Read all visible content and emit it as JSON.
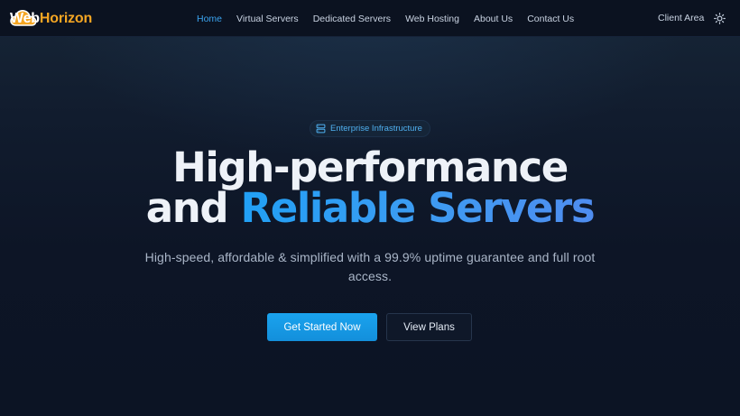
{
  "brand": {
    "name_part1": "Web",
    "name_part2": "Horizon",
    "logo_icon": "cloud-logo-icon"
  },
  "nav": {
    "items": [
      {
        "label": "Home",
        "active": true
      },
      {
        "label": "Virtual Servers",
        "active": false
      },
      {
        "label": "Dedicated Servers",
        "active": false
      },
      {
        "label": "Web Hosting",
        "active": false
      },
      {
        "label": "About Us",
        "active": false
      },
      {
        "label": "Contact Us",
        "active": false
      }
    ],
    "client_area_label": "Client Area",
    "theme_toggle_icon": "sun-icon"
  },
  "hero": {
    "badge": {
      "icon": "server-icon",
      "label": "Enterprise Infrastructure"
    },
    "headline_line1": "High-performance",
    "headline_line2_plain": "and ",
    "headline_line2_accent": "Reliable Servers",
    "subtitle": "High-speed, affordable & simplified with a 99.9% uptime guarantee and full root access.",
    "primary_button": "Get Started Now",
    "secondary_button": "View Plans"
  },
  "colors": {
    "background": "#0d1526",
    "nav_background": "#0b1220",
    "accent_blue": "#1ba1ec",
    "active_link": "#3ba4f0",
    "logo_orange": "#f5a623"
  }
}
